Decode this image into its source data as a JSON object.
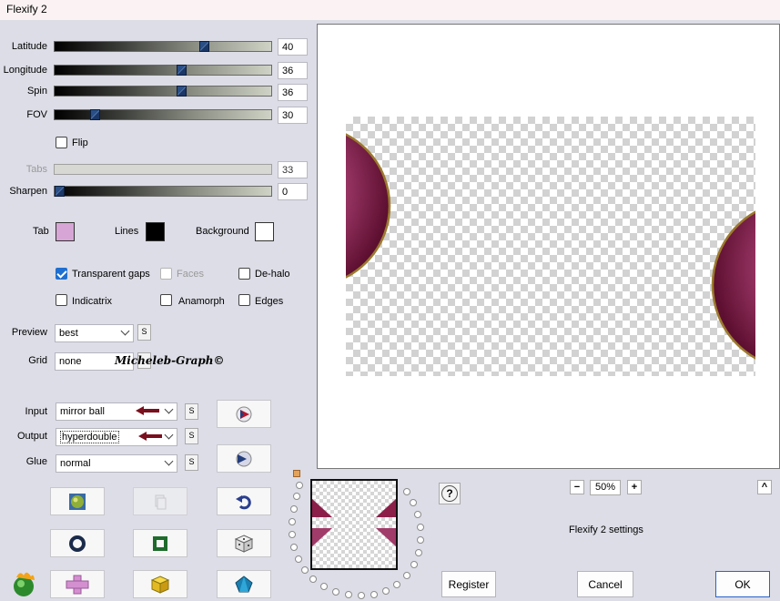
{
  "window": {
    "title": "Flexify 2"
  },
  "sliders": [
    {
      "label": "Latitude",
      "value": "40",
      "level": 0.7,
      "enabled": true
    },
    {
      "label": "Longitude",
      "value": "36",
      "level": 0.59,
      "enabled": true
    },
    {
      "label": "Spin",
      "value": "36",
      "level": 0.59,
      "enabled": true
    },
    {
      "label": "FOV",
      "value": "30",
      "level": 0.17,
      "enabled": true
    }
  ],
  "flip": {
    "label": "Flip",
    "checked": false
  },
  "tabs_slider": {
    "label": "Tabs",
    "value": "33",
    "enabled": false
  },
  "sharpen_slider": {
    "label": "Sharpen",
    "value": "0",
    "level": 0.0
  },
  "colors": {
    "tab": {
      "label": "Tab",
      "color": "#d7a6d6"
    },
    "lines": {
      "label": "Lines",
      "color": "#000000"
    },
    "background": {
      "label": "Background",
      "color": "#ffffff"
    }
  },
  "options": {
    "transparent_gaps": {
      "label": "Transparent gaps",
      "checked": true
    },
    "faces": {
      "label": "Faces",
      "checked": false,
      "enabled": false
    },
    "de_halo": {
      "label": "De-halo",
      "checked": false
    },
    "indicatrix": {
      "label": "Indicatrix",
      "checked": false
    },
    "anamorph": {
      "label": "Anamorph",
      "checked": false
    },
    "edges": {
      "label": "Edges",
      "checked": false
    }
  },
  "preview_select": {
    "label": "Preview",
    "value": "best",
    "s_label": "S"
  },
  "grid_select": {
    "label": "Grid",
    "value": "none"
  },
  "watermark": "Micheleb-Graph©",
  "input_select": {
    "label": "Input",
    "value": "mirror ball",
    "s_label": "S"
  },
  "output_select": {
    "label": "Output",
    "value": "hyperdouble",
    "s_label": "S"
  },
  "glue_select": {
    "label": "Glue",
    "value": "normal",
    "s_label": "S"
  },
  "zoom": {
    "minus": "−",
    "value": "50%",
    "plus": "+"
  },
  "help_label": "?",
  "collapse_label": "^",
  "settings_caption": "Flexify 2 settings",
  "buttons": {
    "register": "Register",
    "cancel": "Cancel",
    "ok": "OK"
  },
  "accent_colors": {
    "ball": "#8c1f49",
    "ball_rim": "#9c7a2e",
    "arrow": "#7a0f1d"
  },
  "icons": [
    "globe-icon",
    "copy-icon",
    "undo-icon",
    "ring-icon",
    "square-frame-icon",
    "dice-icon",
    "cross-icon",
    "cube-icon",
    "pentagon-icon",
    "play-sphere-icon",
    "forward-sphere-icon",
    "flame-logo-icon"
  ]
}
